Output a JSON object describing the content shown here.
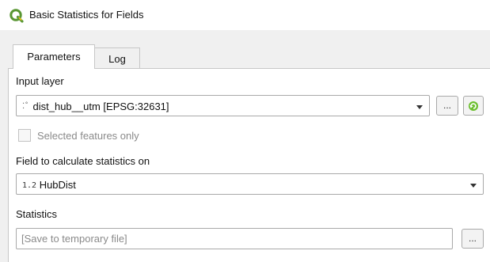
{
  "window": {
    "title": "Basic Statistics for Fields",
    "icon": "qgis-logo-icon",
    "accent_color": "#589632"
  },
  "tabs": [
    {
      "label": "Parameters",
      "active": true
    },
    {
      "label": "Log",
      "active": false
    }
  ],
  "params": {
    "input_layer": {
      "label": "Input layer",
      "value": "dist_hub__utm [EPSG:32631]",
      "type_icon": "point-layer-icon",
      "browse_label": "...",
      "iterate_icon": "iterate-icon"
    },
    "selected_only": {
      "label": "Selected features only",
      "checked": false,
      "enabled": false
    },
    "field": {
      "label": "Field to calculate statistics on",
      "type_prefix": "1.2",
      "value": "HubDist"
    },
    "statistics": {
      "label": "Statistics",
      "placeholder": "[Save to temporary file]",
      "value": "",
      "browse_label": "..."
    }
  }
}
